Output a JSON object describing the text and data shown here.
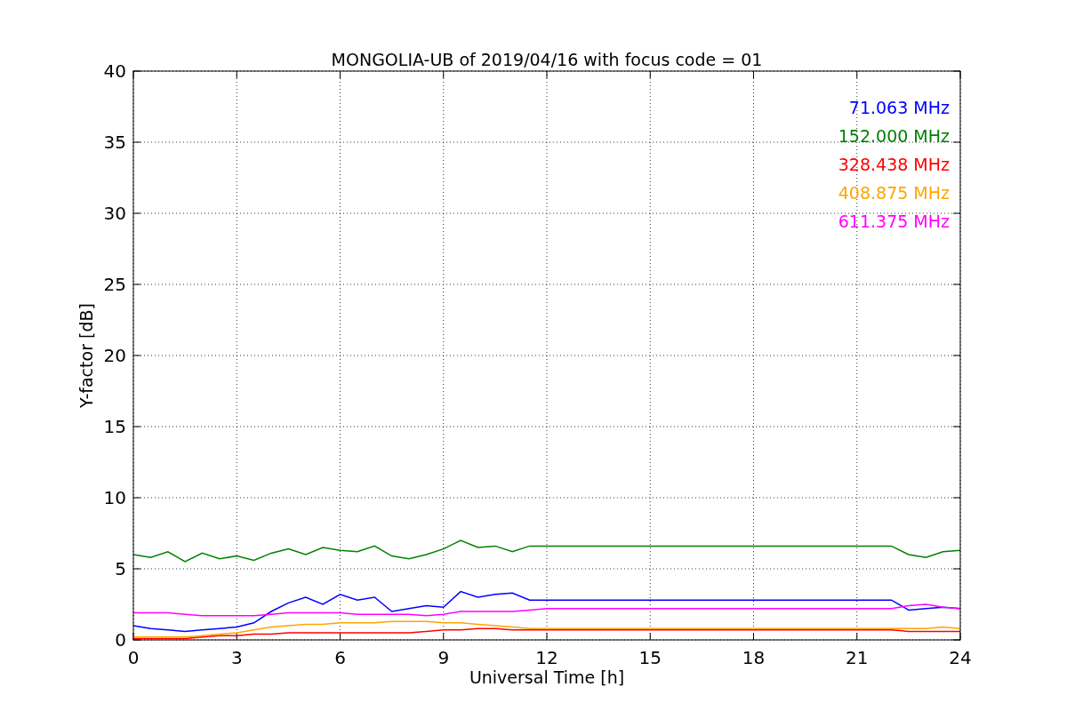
{
  "chart_data": {
    "type": "line",
    "title": "MONGOLIA-UB of 2019/04/16 with focus code = 01",
    "xlabel": "Universal Time [h]",
    "ylabel": "Y-factor [dB]",
    "x": [
      0,
      0.5,
      1,
      1.5,
      2,
      2.5,
      3,
      3.5,
      4,
      4.5,
      5,
      5.5,
      6,
      6.5,
      7,
      7.5,
      8,
      8.5,
      9,
      9.5,
      10,
      10.5,
      11,
      11.5,
      12,
      12.5,
      13,
      13.5,
      14,
      14.5,
      15,
      15.5,
      16,
      16.5,
      17,
      17.5,
      18,
      18.5,
      19,
      19.5,
      20,
      20.5,
      21,
      21.5,
      22,
      22.5,
      23,
      23.5,
      24
    ],
    "series": [
      {
        "name": "71.063 MHz",
        "color": "#0000ff",
        "values": [
          1.0,
          0.8,
          0.7,
          0.6,
          0.7,
          0.8,
          0.9,
          1.2,
          2.0,
          2.6,
          3.0,
          2.5,
          3.2,
          2.8,
          3.0,
          2.0,
          2.2,
          2.4,
          2.3,
          3.4,
          3.0,
          3.2,
          3.3,
          2.8,
          2.8,
          2.8,
          2.8,
          2.8,
          2.8,
          2.8,
          2.8,
          2.8,
          2.8,
          2.8,
          2.8,
          2.8,
          2.8,
          2.8,
          2.8,
          2.8,
          2.8,
          2.8,
          2.8,
          2.8,
          2.8,
          2.1,
          2.2,
          2.3,
          2.2
        ]
      },
      {
        "name": "152.000 MHz",
        "color": "#008000",
        "values": [
          6.0,
          5.8,
          6.2,
          5.5,
          6.1,
          5.7,
          5.9,
          5.6,
          6.1,
          6.4,
          6.0,
          6.5,
          6.3,
          6.2,
          6.6,
          5.9,
          5.7,
          6.0,
          6.4,
          7.0,
          6.5,
          6.6,
          6.2,
          6.6,
          6.6,
          6.6,
          6.6,
          6.6,
          6.6,
          6.6,
          6.6,
          6.6,
          6.6,
          6.6,
          6.6,
          6.6,
          6.6,
          6.6,
          6.6,
          6.6,
          6.6,
          6.6,
          6.6,
          6.6,
          6.6,
          6.0,
          5.8,
          6.2,
          6.3
        ]
      },
      {
        "name": "328.438 MHz",
        "color": "#ff0000",
        "values": [
          0.1,
          0.1,
          0.1,
          0.1,
          0.2,
          0.3,
          0.3,
          0.4,
          0.4,
          0.5,
          0.5,
          0.5,
          0.5,
          0.5,
          0.5,
          0.5,
          0.5,
          0.6,
          0.7,
          0.7,
          0.8,
          0.8,
          0.7,
          0.7,
          0.7,
          0.7,
          0.7,
          0.7,
          0.7,
          0.7,
          0.7,
          0.7,
          0.7,
          0.7,
          0.7,
          0.7,
          0.7,
          0.7,
          0.7,
          0.7,
          0.7,
          0.7,
          0.7,
          0.7,
          0.7,
          0.6,
          0.6,
          0.6,
          0.6
        ]
      },
      {
        "name": "408.875 MHz",
        "color": "#ffa500",
        "values": [
          0.2,
          0.2,
          0.2,
          0.2,
          0.3,
          0.4,
          0.5,
          0.7,
          0.9,
          1.0,
          1.1,
          1.1,
          1.2,
          1.2,
          1.2,
          1.3,
          1.3,
          1.3,
          1.2,
          1.2,
          1.1,
          1.0,
          0.9,
          0.8,
          0.8,
          0.8,
          0.8,
          0.8,
          0.8,
          0.8,
          0.8,
          0.8,
          0.8,
          0.8,
          0.8,
          0.8,
          0.8,
          0.8,
          0.8,
          0.8,
          0.8,
          0.8,
          0.8,
          0.8,
          0.8,
          0.8,
          0.8,
          0.9,
          0.8
        ]
      },
      {
        "name": "611.375 MHz",
        "color": "#ff00ff",
        "values": [
          1.9,
          1.9,
          1.9,
          1.8,
          1.7,
          1.7,
          1.7,
          1.7,
          1.8,
          1.9,
          1.9,
          1.9,
          1.9,
          1.8,
          1.8,
          1.8,
          1.8,
          1.7,
          1.8,
          2.0,
          2.0,
          2.0,
          2.0,
          2.1,
          2.2,
          2.2,
          2.2,
          2.2,
          2.2,
          2.2,
          2.2,
          2.2,
          2.2,
          2.2,
          2.2,
          2.2,
          2.2,
          2.2,
          2.2,
          2.2,
          2.2,
          2.2,
          2.2,
          2.2,
          2.2,
          2.4,
          2.5,
          2.3,
          2.2
        ]
      }
    ],
    "xlim": [
      0,
      24
    ],
    "ylim": [
      0,
      40
    ],
    "xticks": [
      0,
      3,
      6,
      9,
      12,
      15,
      18,
      21,
      24
    ],
    "yticks": [
      0,
      5,
      10,
      15,
      20,
      25,
      30,
      35,
      40
    ],
    "grid": true
  }
}
